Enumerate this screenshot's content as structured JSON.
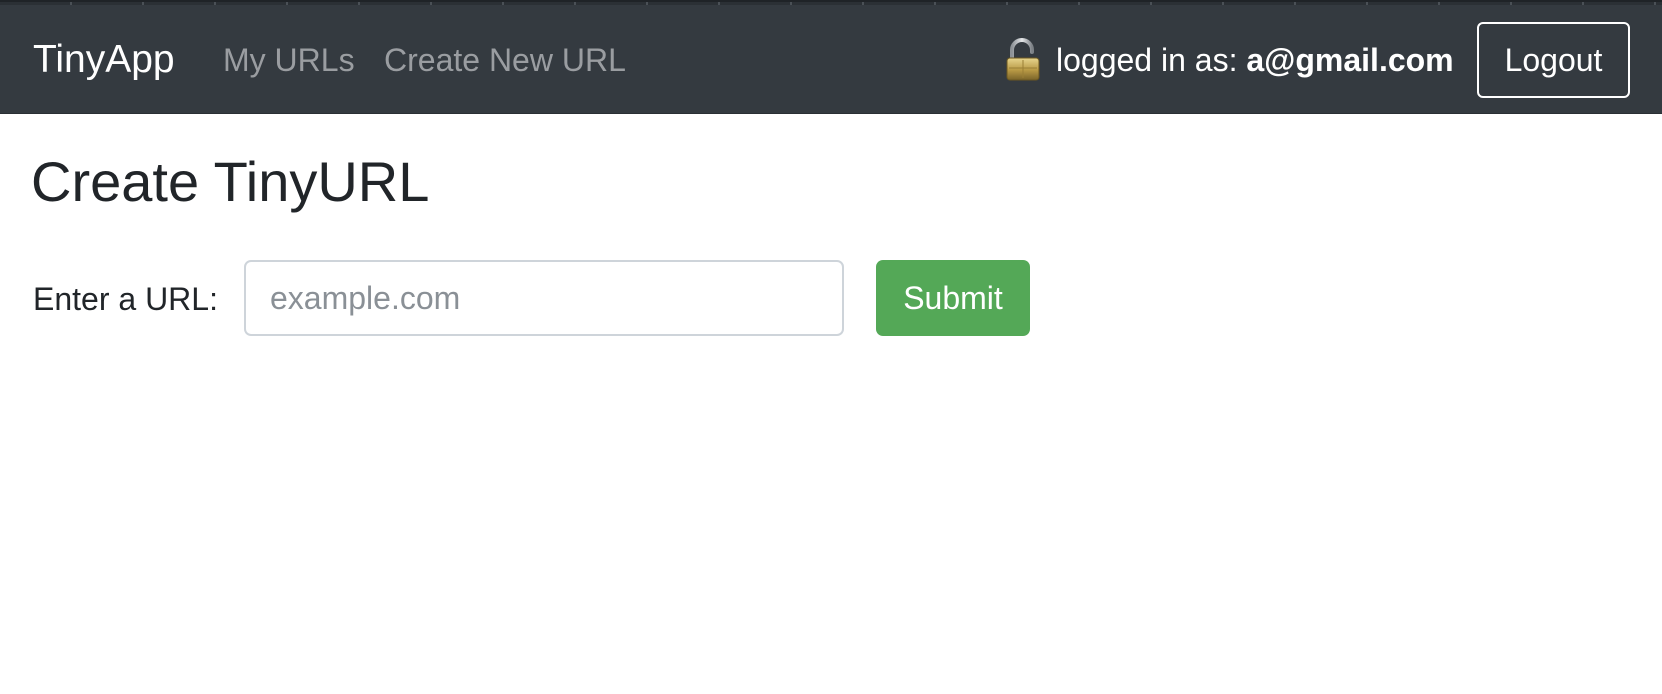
{
  "navbar": {
    "brand": "TinyApp",
    "links": [
      {
        "label": "My URLs"
      },
      {
        "label": "Create New URL"
      }
    ],
    "status_prefix": "logged in as: ",
    "user_email": "a@gmail.com",
    "logout_label": "Logout",
    "lock_icon": "open-padlock-icon",
    "colors": {
      "background": "#343a40",
      "brand_text": "#ffffff",
      "link_text": "#9a9da1"
    }
  },
  "main": {
    "title": "Create TinyURL",
    "form": {
      "label": "Enter a URL:",
      "input_value": "",
      "input_placeholder": "example.com",
      "submit_label": "Submit",
      "submit_color": "#54a857"
    }
  }
}
